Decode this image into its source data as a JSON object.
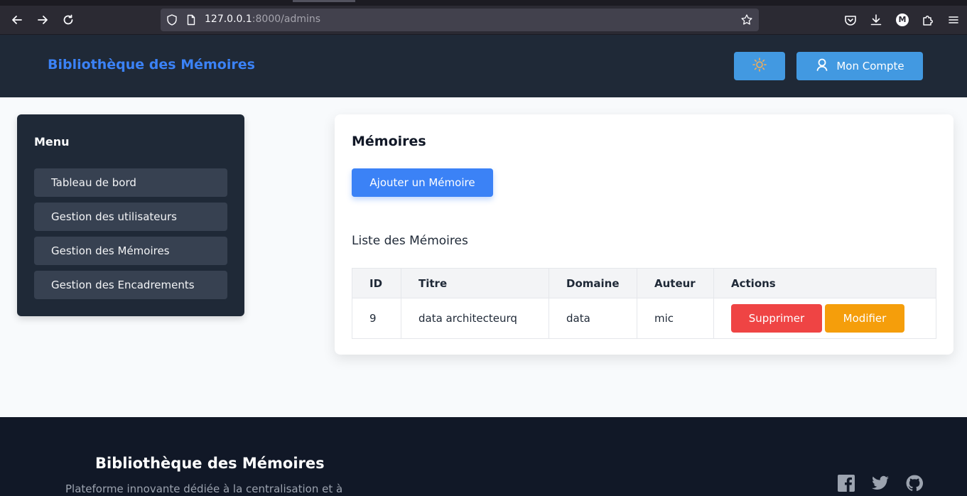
{
  "browser": {
    "url_host": "127.0.0.1",
    "url_path": ":8000/admins",
    "profile_initial": "M"
  },
  "header": {
    "brand": "Bibliothèque des Mémoires",
    "account_label": "Mon Compte",
    "colors": {
      "brand": "#3b82f6",
      "button": "#4299e1",
      "sun_icon": "#f6ad55"
    }
  },
  "sidebar": {
    "title": "Menu",
    "items": [
      {
        "label": "Tableau de bord"
      },
      {
        "label": "Gestion des utilisateurs"
      },
      {
        "label": "Gestion des Mémoires"
      },
      {
        "label": "Gestion des Encadrements"
      }
    ]
  },
  "main": {
    "title": "Mémoires",
    "add_button": "Ajouter un Mémoire",
    "list_title": "Liste des Mémoires",
    "table": {
      "headers": [
        "ID",
        "Titre",
        "Domaine",
        "Auteur",
        "Actions"
      ],
      "rows": [
        {
          "id": "9",
          "titre": "data architecteurq",
          "domaine": "data",
          "auteur": "mic",
          "delete_label": "Supprimer",
          "edit_label": "Modifier"
        }
      ]
    },
    "colors": {
      "add": "#3b82f6",
      "delete": "#ef4444",
      "edit": "#f59e0b"
    }
  },
  "footer": {
    "title": "Bibliothèque des Mémoires",
    "description": "Plateforme innovante dédiée à la centralisation et à",
    "social_icons": [
      "facebook-icon",
      "twitter-icon",
      "github-icon"
    ]
  }
}
